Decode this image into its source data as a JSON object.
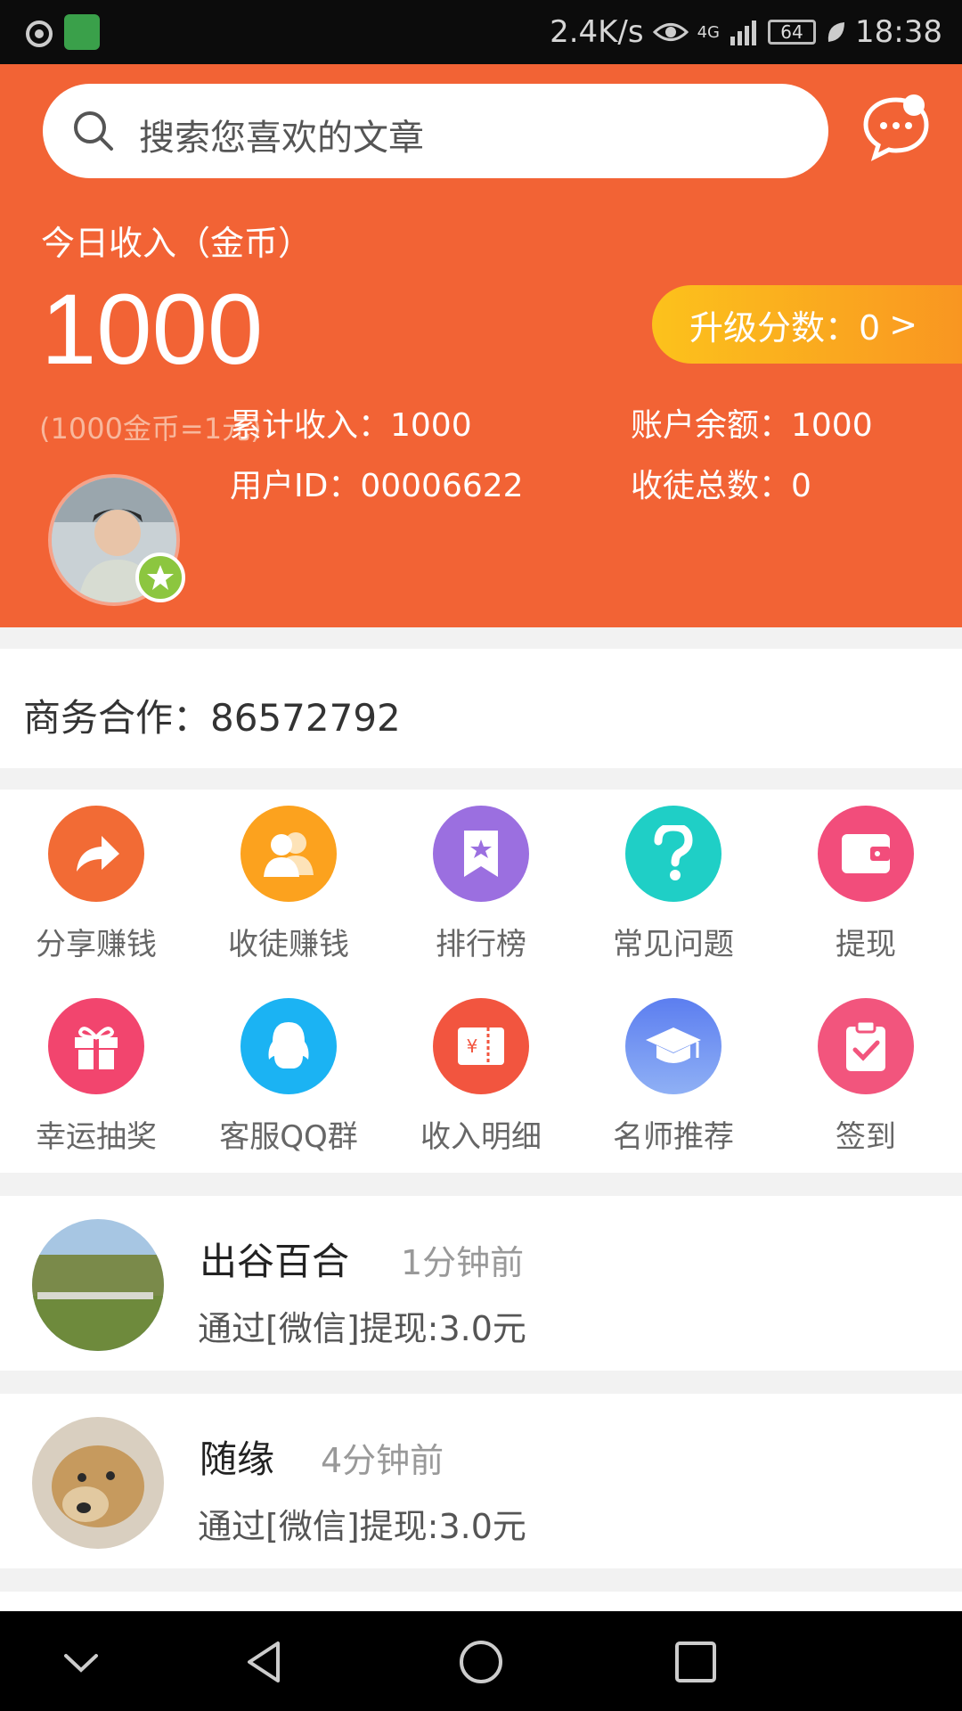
{
  "status_bar": {
    "speed": "2.4K/s",
    "network": "4G",
    "battery": "64",
    "time": "18:38"
  },
  "search": {
    "placeholder": "搜索您喜欢的文章"
  },
  "income": {
    "label": "今日收入（金币）",
    "value": "1000",
    "rate_note": "(1000金币=1元)"
  },
  "upgrade": {
    "label": "升级分数：0",
    "chevron": ">"
  },
  "stats": {
    "total_income": "累计收入：1000",
    "balance": "账户余额：1000",
    "user_id": "用户ID：00006622",
    "disciples": "收徒总数：0"
  },
  "business": {
    "text": "商务合作：86572792"
  },
  "menu": [
    {
      "label": "分享赚钱",
      "icon": "share-arrow-icon",
      "color": "#f26b35"
    },
    {
      "label": "收徒赚钱",
      "icon": "people-icon",
      "color": "#fca21e"
    },
    {
      "label": "排行榜",
      "icon": "bookmark-star-icon",
      "color": "#9b6fe0"
    },
    {
      "label": "常见问题",
      "icon": "question-icon",
      "color": "#1fcfc6"
    },
    {
      "label": "提现",
      "icon": "wallet-icon",
      "color": "#f24d7b"
    },
    {
      "label": "幸运抽奖",
      "icon": "gift-icon",
      "color": "#f2456e"
    },
    {
      "label": "客服QQ群",
      "icon": "qq-icon",
      "color": "#1bb3f3"
    },
    {
      "label": "收入明细",
      "icon": "ticket-icon",
      "color": "#f2553f"
    },
    {
      "label": "名师推荐",
      "icon": "graduation-cap-icon",
      "color": "#6b8df0"
    },
    {
      "label": "签到",
      "icon": "clipboard-check-icon",
      "color": "#f2557d"
    }
  ],
  "feed": [
    {
      "name": "出谷百合",
      "time": "1分钟前",
      "message": "通过[微信]提现:3.0元"
    },
    {
      "name": "随缘",
      "time": "4分钟前",
      "message": "通过[微信]提现:3.0元"
    }
  ],
  "colors": {
    "brand": "#f26335",
    "upgrade_start": "#fcc21c",
    "upgrade_end": "#f99621"
  }
}
